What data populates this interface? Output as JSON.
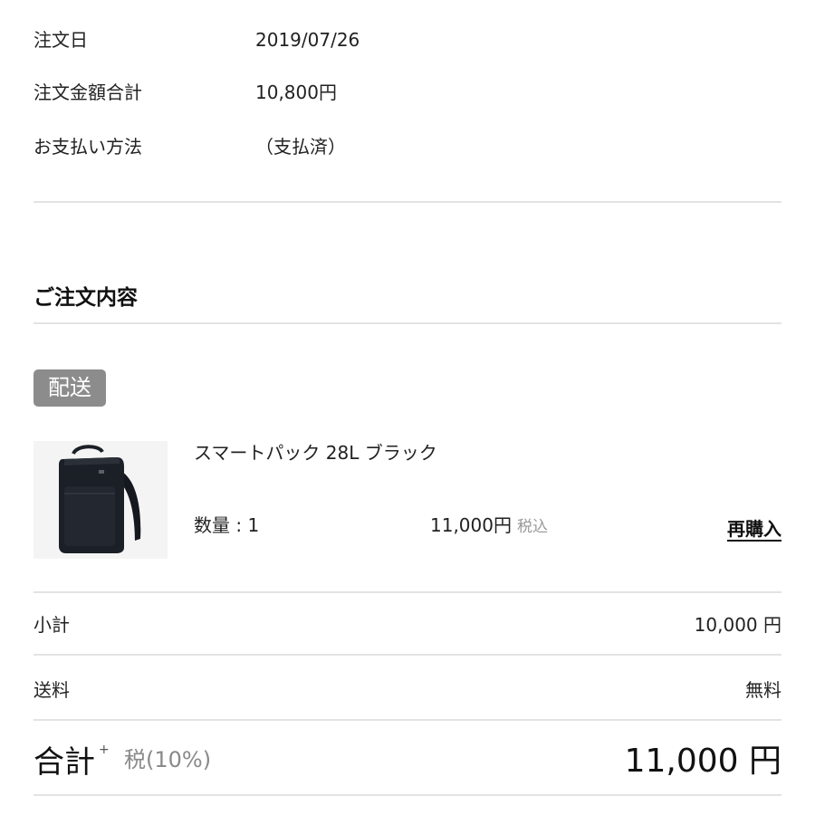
{
  "order_info": {
    "date_label": "注文日",
    "date_value": "2019/07/26",
    "amount_label": "注文金額合計",
    "amount_value": "10,800円",
    "payment_label": "お支払い方法",
    "payment_value": "（支払済）"
  },
  "order_contents": {
    "title": "ご注文内容",
    "delivery_badge": "配送",
    "product": {
      "image_icon": "backpack-icon",
      "name": "スマートパック 28L ブラック",
      "quantity": "数量 : 1",
      "price": "11,000円",
      "tax_note": "税込",
      "rebuy_label": "再購入"
    }
  },
  "summary": {
    "subtotal_label": "小計",
    "subtotal_value": "10,000 円",
    "shipping_label": "送料",
    "shipping_value": "無料",
    "total_label": "合計",
    "total_plus": "+",
    "total_tax": "税(10%)",
    "total_value": "11,000 円"
  },
  "colors": {
    "badge_bg": "#8c8c8c",
    "divider": "#e3e3e3",
    "backpack": "#1b1f26"
  }
}
